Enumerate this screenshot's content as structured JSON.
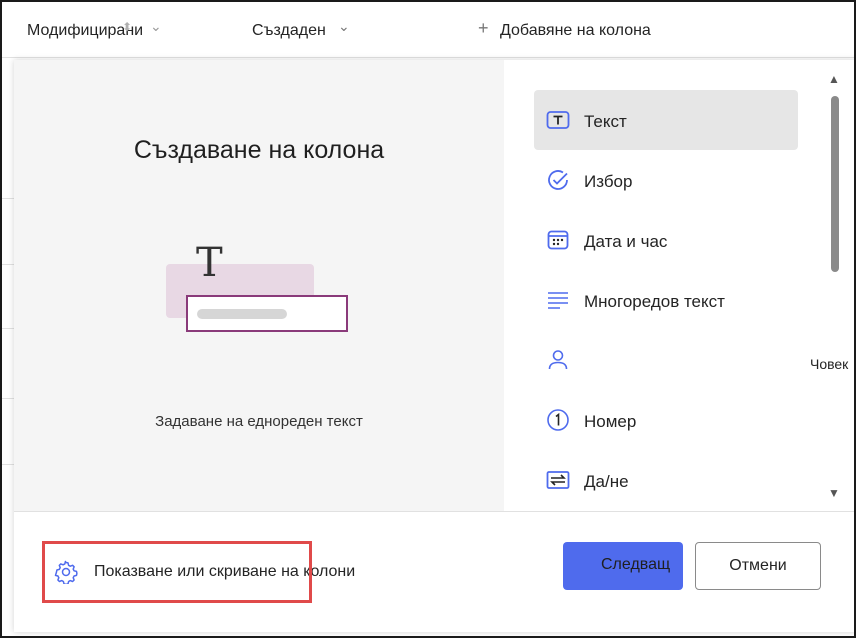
{
  "header": {
    "modified_label": "Модифицирани",
    "created_label": "Създаден",
    "add_column_label": "Добавяне на колона"
  },
  "dialog": {
    "title": "Създаване на колона",
    "preview_description": "Задаване на еднореден текст",
    "types": [
      {
        "label": "Текст",
        "icon": "text-icon",
        "selected": true
      },
      {
        "label": "Избор",
        "icon": "check-circle-icon",
        "selected": false
      },
      {
        "label": "Дата и час",
        "icon": "calendar-icon",
        "selected": false
      },
      {
        "label": "Многоредов текст",
        "icon": "multiline-text-icon",
        "selected": false
      },
      {
        "label": "Човек",
        "icon": "person-icon",
        "selected": false
      },
      {
        "label": "Номер",
        "icon": "number-icon",
        "selected": false
      },
      {
        "label": "Да/не",
        "icon": "yes-no-icon",
        "selected": false
      }
    ],
    "footer": {
      "show_hide_label": "Показване или скриване на колони",
      "next_label": "Следващ",
      "cancel_label": "Отмени"
    }
  },
  "colors": {
    "accent": "#4f6bed",
    "highlight": "#e04a4a",
    "selected_bg": "#e6e6e6"
  }
}
